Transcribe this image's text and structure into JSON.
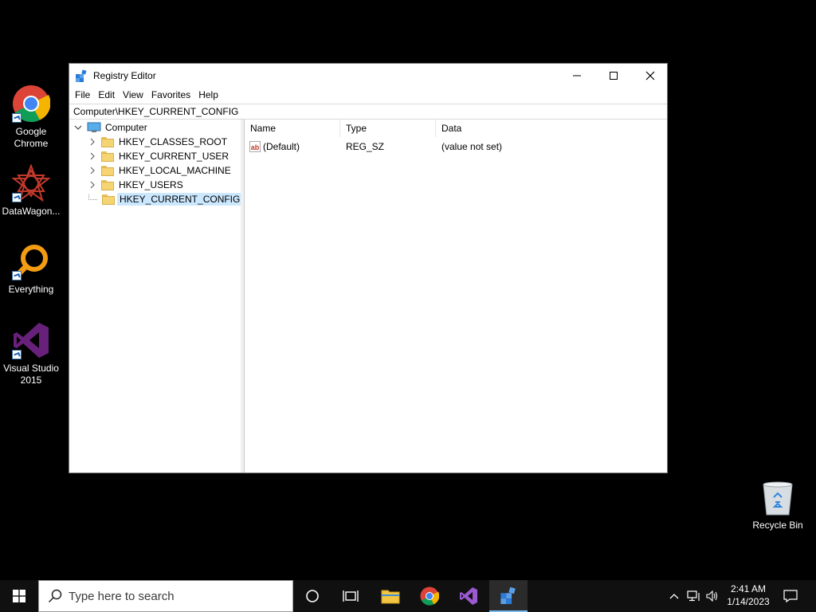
{
  "desktop": {
    "icons": [
      {
        "label": "Google Chrome"
      },
      {
        "label": "DataWagon..."
      },
      {
        "label": "Everything"
      },
      {
        "label": "Visual Studio 2015"
      }
    ],
    "recycle_bin": {
      "label": "Recycle Bin"
    }
  },
  "window": {
    "title": "Registry Editor",
    "menu": [
      "File",
      "Edit",
      "View",
      "Favorites",
      "Help"
    ],
    "address": "Computer\\HKEY_CURRENT_CONFIG",
    "tree": {
      "root": "Computer",
      "keys": [
        "HKEY_CLASSES_ROOT",
        "HKEY_CURRENT_USER",
        "HKEY_LOCAL_MACHINE",
        "HKEY_USERS",
        "HKEY_CURRENT_CONFIG"
      ]
    },
    "list": {
      "columns": [
        "Name",
        "Type",
        "Data"
      ],
      "rows": [
        {
          "name": "(Default)",
          "type": "REG_SZ",
          "data": "(value not set)",
          "icon": "ab"
        }
      ]
    }
  },
  "taskbar": {
    "search_placeholder": "Type here to search",
    "time": "2:41 AM",
    "date": "1/14/2023"
  },
  "colors": {
    "accent": "#76b9ed",
    "selection": "#cce8ff",
    "desktop": "#000000",
    "taskbar": "#101010"
  }
}
